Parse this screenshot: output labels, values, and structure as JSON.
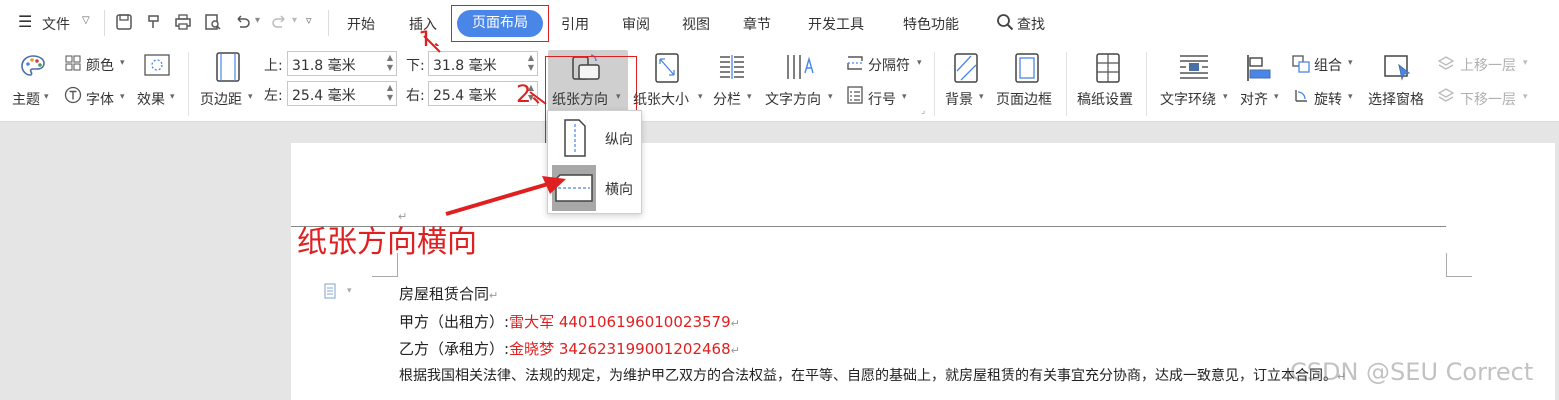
{
  "topbar": {
    "file_menu": "文件",
    "tabs": [
      "开始",
      "插入",
      "页面布局",
      "引用",
      "审阅",
      "视图",
      "章节",
      "开发工具",
      "特色功能"
    ],
    "active_tab": "页面布局",
    "search": "查找"
  },
  "ribbon": {
    "theme": "主题",
    "colors": "颜色",
    "fonts": "字体",
    "effects": "效果",
    "margins": "页边距",
    "margin_top_label": "上:",
    "margin_top": "31.8 毫米",
    "margin_bottom_label": "下:",
    "margin_bottom": "31.8 毫米",
    "margin_left_label": "左:",
    "margin_left": "25.4 毫米",
    "margin_right_label": "右:",
    "margin_right": "25.4 毫米",
    "orientation": "纸张方向",
    "size": "纸张大小",
    "columns": "分栏",
    "text_direction": "文字方向",
    "separator": "分隔符",
    "line_numbers": "行号",
    "background": "背景",
    "page_border": "页面边框",
    "manuscript": "稿纸设置",
    "text_wrap": "文字环绕",
    "align": "对齐",
    "group": "组合",
    "rotate": "旋转",
    "selection_pane": "选择窗格",
    "bring_forward": "上移一层",
    "send_backward": "下移一层"
  },
  "dropdown": {
    "portrait": "纵向",
    "landscape": "横向"
  },
  "annotations": {
    "step1": "1、",
    "step2": "2、",
    "caption": "纸张方向横向"
  },
  "document": {
    "line1": "房屋租赁合同",
    "line2_label": "甲方（出租方）:",
    "line2_value": "雷大军 440106196010023579",
    "line3_label": "乙方（承租方）:",
    "line3_value": "金晓梦 342623199001202468",
    "line4": "根据我国相关法律、法规的规定，为维护甲乙双方的合法权益，在平等、自愿的基础上，就房屋租赁的有关事宜充分协商，达成一致意见，订立本合同。"
  },
  "watermark": "CSDN @SEU Correct",
  "colors": {
    "accent": "#4a86e8",
    "annotation_red": "#e02020"
  }
}
